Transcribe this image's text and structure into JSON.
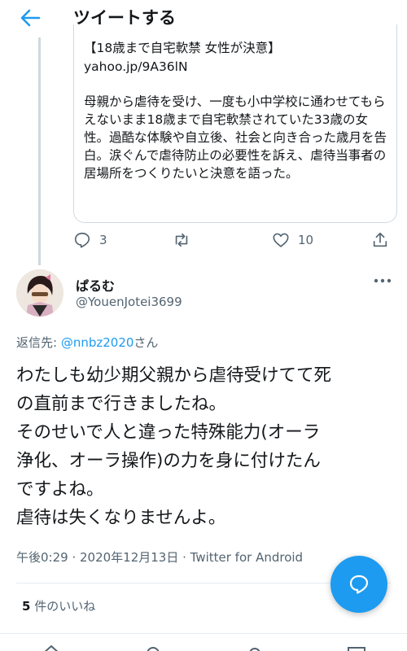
{
  "header": {
    "title": "ツイートする",
    "back_icon": "arrow-left-icon",
    "accent_color": "#1d9bf0"
  },
  "quoted_card": {
    "title": "【18歳まで自宅軟禁 女性が決意】",
    "link": "yahoo.jp/9A36lN",
    "description": "母親から虐待を受け、一度も小中学校に通わせてもらえないまま18歳まで自宅軟禁されていた33歳の女性。過酷な体験や自立後、社会と向き合った歳月を告白。涙ぐんで虐待防止の必要性を訴え、虐待当事者の居場所をつくりたいと決意を語った。"
  },
  "parent_actions": {
    "reply_count": "3",
    "like_count": "10"
  },
  "tweet": {
    "display_name": "ぱるむ",
    "handle": "@YouenJotei3699",
    "reply_prefix": "返信先: ",
    "reply_mention": "@nnbz2020",
    "reply_suffix": "さん",
    "text": "わたしも幼少期父親から虐待受けてて死\nの直前まで行きましたね。\nそのせいで人と違った特殊能力(オーラ\n浄化、オーラ操作)の力を身に付けたん\nですよね。\n虐待は失くなりませんよ。",
    "meta": "午後0:29 · 2020年12月13日 · Twitter for Android",
    "likes_count": "5",
    "likes_label": " 件のいいね"
  },
  "colors": {
    "text_primary": "#14171a",
    "text_secondary": "#536471",
    "link_blue": "#1d9bf0",
    "border": "#cfd9de"
  }
}
